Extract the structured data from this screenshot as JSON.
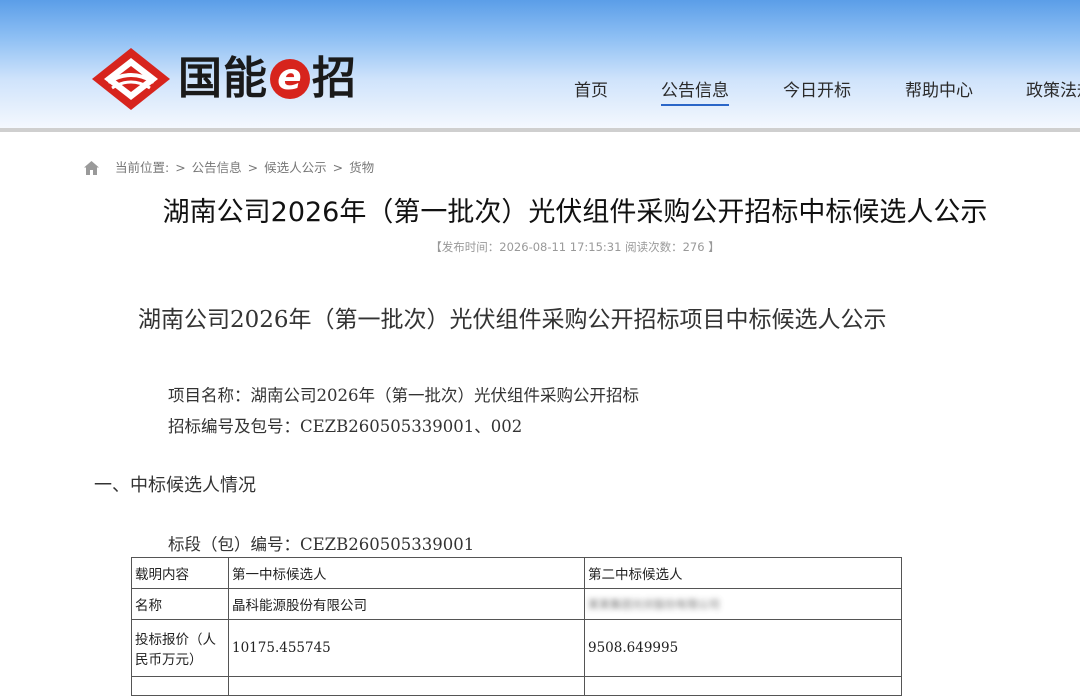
{
  "header": {
    "logo_text_left": "国能",
    "logo_text_e": "e",
    "logo_text_right": "招",
    "colors": {
      "brand_red": "#d7241d",
      "nav_active_underline": "#2a66c8"
    },
    "nav": [
      {
        "label": "首页"
      },
      {
        "label": "公告信息",
        "active": true
      },
      {
        "label": "今日开标"
      },
      {
        "label": "帮助中心"
      },
      {
        "label": "政策法规"
      }
    ]
  },
  "breadcrumb": {
    "icon": "home-icon",
    "prefix": "当前位置:",
    "items": [
      "公告信息",
      "候选人公示",
      "货物"
    ],
    "separator": ">"
  },
  "page_title": "湖南公司2026年（第一批次）光伏组件采购公开招标中标候选人公示",
  "meta": "【发布时间：2026-08-11 17:15:31 阅读次数：276 】",
  "document": {
    "title": "湖南公司2026年（第一批次）光伏组件采购公开招标项目中标候选人公示",
    "project_line": "项目名称：湖南公司2026年（第一批次）光伏组件采购公开招标",
    "code_line": "招标编号及包号：CEZB260505339001、002",
    "section_1": "一、中标候选人情况",
    "segment_line": "标段（包）编号：CEZB260505339001",
    "table": {
      "headers": [
        "载明内容",
        "第一中标候选人",
        "第二中标候选人"
      ],
      "rows": [
        {
          "label": "名称",
          "first": "晶科能源股份有限公司",
          "second": "某某集团光伏股份有限公司"
        },
        {
          "label": "投标报价（人民币万元）",
          "first": "10175.455745",
          "second": "9508.649995"
        }
      ]
    }
  }
}
